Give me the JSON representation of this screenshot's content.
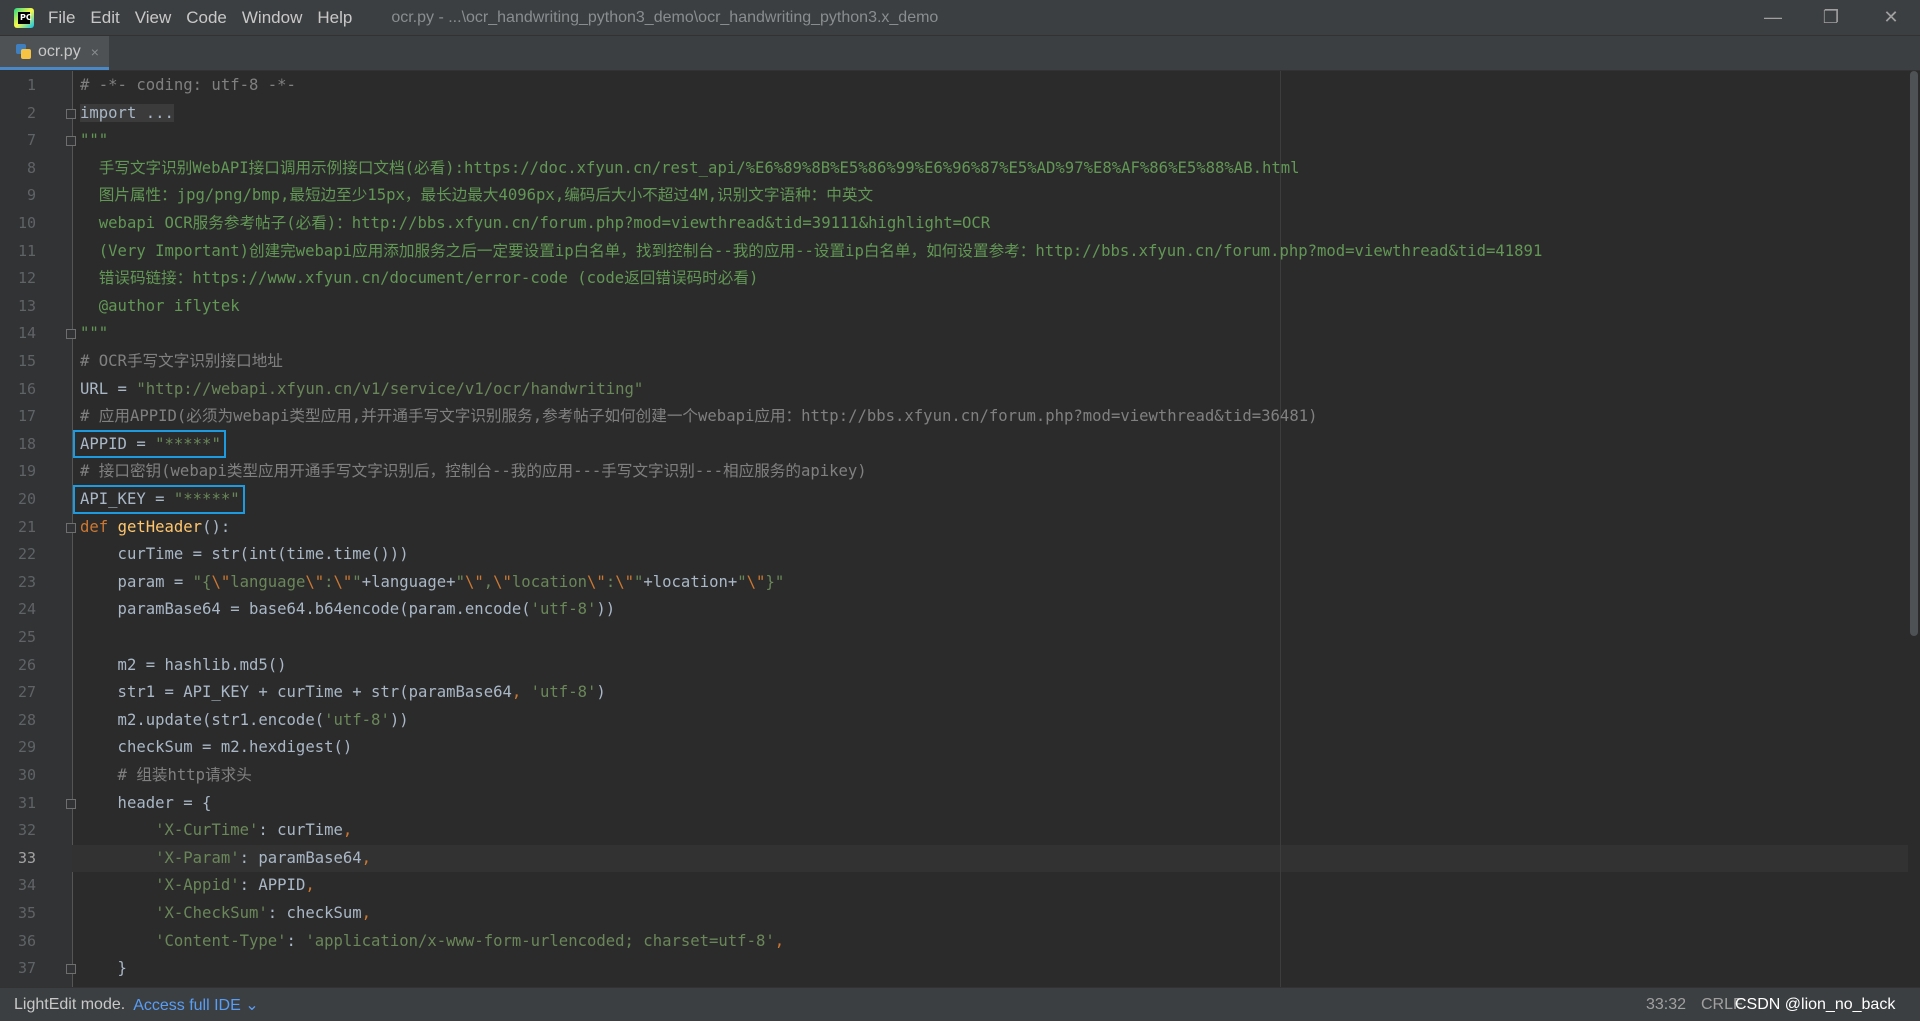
{
  "titlebar": {
    "menu": [
      "File",
      "Edit",
      "View",
      "Code",
      "Window",
      "Help"
    ],
    "title": "ocr.py - ...\\ocr_handwriting_python3_demo\\ocr_handwriting_python3.x_demo",
    "logo_text": "PC"
  },
  "tab": {
    "label": "ocr.py",
    "close": "×"
  },
  "editor": {
    "line_numbers": [
      "1",
      "2",
      "7",
      "8",
      "9",
      "10",
      "11",
      "12",
      "13",
      "14",
      "15",
      "16",
      "17",
      "18",
      "19",
      "20",
      "21",
      "22",
      "23",
      "24",
      "25",
      "26",
      "27",
      "28",
      "29",
      "30",
      "31",
      "32",
      "33",
      "34",
      "35",
      "36",
      "37"
    ],
    "current_line": "33",
    "highlighted_lines": [
      "18",
      "20"
    ],
    "lines": [
      [
        {
          "t": "# -*- coding: utf-8 -*-",
          "c": "c-comment"
        }
      ],
      [
        {
          "t": "import ...",
          "c": "folded"
        }
      ],
      [
        {
          "t": "\"\"\"",
          "c": "c-doc"
        }
      ],
      [
        {
          "t": "  手写文字识别WebAPI接口调用示例接口文档(必看):https://doc.xfyun.cn/rest_api/%E6%89%8B%E5%86%99%E6%96%87%E5%AD%97%E8%AF%86%E5%88%AB.html",
          "c": "c-doc"
        }
      ],
      [
        {
          "t": "  图片属性：jpg/png/bmp,最短边至少15px，最长边最大4096px,编码后大小不超过4M,识别文字语种：中英文",
          "c": "c-doc"
        }
      ],
      [
        {
          "t": "  webapi OCR服务参考帖子(必看)：http://bbs.xfyun.cn/forum.php?mod=viewthread&tid=39111&highlight=OCR",
          "c": "c-doc"
        }
      ],
      [
        {
          "t": "  (Very Important)创建完webapi应用添加服务之后一定要设置ip白名单，找到控制台--我的应用--设置ip白名单，如何设置参考：http://bbs.xfyun.cn/forum.php?mod=viewthread&tid=41891",
          "c": "c-doc"
        }
      ],
      [
        {
          "t": "  错误码链接：https://www.xfyun.cn/document/error-code (code返回错误码时必看)",
          "c": "c-doc"
        }
      ],
      [
        {
          "t": "  @author iflytek",
          "c": "c-doc"
        }
      ],
      [
        {
          "t": "\"\"\"",
          "c": "c-doc"
        }
      ],
      [
        {
          "t": "# OCR手写文字识别接口地址",
          "c": "c-comment"
        }
      ],
      [
        {
          "t": "URL = ",
          "c": "c-id"
        },
        {
          "t": "\"http://webapi.xfyun.cn/v1/service/v1/ocr/handwriting\"",
          "c": "c-str"
        }
      ],
      [
        {
          "t": "# 应用APPID(必须为webapi类型应用,并开通手写文字识别服务,参考帖子如何创建一个webapi应用：http://bbs.xfyun.cn/forum.php?mod=viewthread&tid=36481)",
          "c": "c-comment"
        }
      ],
      [
        {
          "t": "APPID = ",
          "c": "c-id"
        },
        {
          "t": "\"*****\"",
          "c": "c-str"
        }
      ],
      [
        {
          "t": "# 接口密钥(webapi类型应用开通手写文字识别后，控制台--我的应用---手写文字识别---相应服务的apikey)",
          "c": "c-comment"
        }
      ],
      [
        {
          "t": "API_KEY = ",
          "c": "c-id"
        },
        {
          "t": "\"*****\"",
          "c": "c-str"
        }
      ],
      [
        {
          "t": "def ",
          "c": "c-kw"
        },
        {
          "t": "getHeader",
          "c": "c-fn"
        },
        {
          "t": "():",
          "c": "c-id"
        }
      ],
      [
        {
          "t": "    curTime = str(int(time.time()))",
          "c": "c-id"
        }
      ],
      [
        {
          "t": "    param = ",
          "c": "c-id"
        },
        {
          "t": "\"{",
          "c": "c-str"
        },
        {
          "t": "\\\"",
          "c": "c-kw"
        },
        {
          "t": "language",
          "c": "c-str"
        },
        {
          "t": "\\\"",
          "c": "c-kw"
        },
        {
          "t": ":",
          "c": "c-str"
        },
        {
          "t": "\\\"",
          "c": "c-kw"
        },
        {
          "t": "\"",
          "c": "c-str"
        },
        {
          "t": "+language+",
          "c": "c-id"
        },
        {
          "t": "\"",
          "c": "c-str"
        },
        {
          "t": "\\\"",
          "c": "c-kw"
        },
        {
          "t": ",",
          "c": "c-str"
        },
        {
          "t": "\\\"",
          "c": "c-kw"
        },
        {
          "t": "location",
          "c": "c-str"
        },
        {
          "t": "\\\"",
          "c": "c-kw"
        },
        {
          "t": ":",
          "c": "c-str"
        },
        {
          "t": "\\\"",
          "c": "c-kw"
        },
        {
          "t": "\"",
          "c": "c-str"
        },
        {
          "t": "+location+",
          "c": "c-id"
        },
        {
          "t": "\"",
          "c": "c-str"
        },
        {
          "t": "\\\"",
          "c": "c-kw"
        },
        {
          "t": "}\"",
          "c": "c-str"
        }
      ],
      [
        {
          "t": "    paramBase64 = base64.b64encode(param.encode(",
          "c": "c-id"
        },
        {
          "t": "'utf-8'",
          "c": "c-str"
        },
        {
          "t": "))",
          "c": "c-id"
        }
      ],
      [
        {
          "t": "",
          "c": "c-id"
        }
      ],
      [
        {
          "t": "    m2 = hashlib.md5()",
          "c": "c-id"
        }
      ],
      [
        {
          "t": "    str1 = API_KEY + curTime + str(paramBase64",
          "c": "c-id"
        },
        {
          "t": ", ",
          "c": "c-kw"
        },
        {
          "t": "'utf-8'",
          "c": "c-str"
        },
        {
          "t": ")",
          "c": "c-id"
        }
      ],
      [
        {
          "t": "    m2.update(str1.encode(",
          "c": "c-id"
        },
        {
          "t": "'utf-8'",
          "c": "c-str"
        },
        {
          "t": "))",
          "c": "c-id"
        }
      ],
      [
        {
          "t": "    checkSum = m2.hexdigest()",
          "c": "c-id"
        }
      ],
      [
        {
          "t": "    # 组装http请求头",
          "c": "c-comment"
        }
      ],
      [
        {
          "t": "    header = {",
          "c": "c-id"
        }
      ],
      [
        {
          "t": "        ",
          "c": "c-id"
        },
        {
          "t": "'X-CurTime'",
          "c": "c-str"
        },
        {
          "t": ": curTime",
          "c": "c-id"
        },
        {
          "t": ",",
          "c": "c-kw"
        }
      ],
      [
        {
          "t": "        ",
          "c": "c-id"
        },
        {
          "t": "'X-Param'",
          "c": "c-str"
        },
        {
          "t": ": paramBase64",
          "c": "c-id"
        },
        {
          "t": ",",
          "c": "c-kw"
        }
      ],
      [
        {
          "t": "        ",
          "c": "c-id"
        },
        {
          "t": "'X-Appid'",
          "c": "c-str"
        },
        {
          "t": ": APPID",
          "c": "c-id"
        },
        {
          "t": ",",
          "c": "c-kw"
        }
      ],
      [
        {
          "t": "        ",
          "c": "c-id"
        },
        {
          "t": "'X-CheckSum'",
          "c": "c-str"
        },
        {
          "t": ": checkSum",
          "c": "c-id"
        },
        {
          "t": ",",
          "c": "c-kw"
        }
      ],
      [
        {
          "t": "        ",
          "c": "c-id"
        },
        {
          "t": "'Content-Type'",
          "c": "c-str"
        },
        {
          "t": ": ",
          "c": "c-id"
        },
        {
          "t": "'application/x-www-form-urlencoded; charset=utf-8'",
          "c": "c-str"
        },
        {
          "t": ",",
          "c": "c-kw"
        }
      ],
      [
        {
          "t": "    }",
          "c": "c-id"
        }
      ]
    ],
    "fold_markers": [
      "2",
      "7",
      "14",
      "21",
      "31",
      "37"
    ]
  },
  "statusbar": {
    "mode": "LightEdit mode.",
    "link": "Access full IDE",
    "position": "33:32",
    "eol": "CRLF",
    "watermark": "CSDN @lion_no_back"
  },
  "colors": {
    "background": "#2b2b2b",
    "comment": "#808080",
    "docstring": "#629755",
    "string": "#6a8759",
    "keyword": "#cc7832",
    "function": "#ffc66d",
    "highlight_box": "#1e9be0"
  }
}
